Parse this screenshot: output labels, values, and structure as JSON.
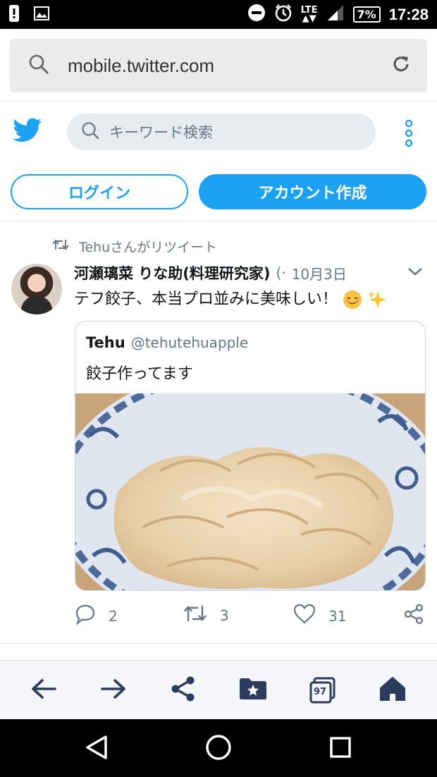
{
  "status_bar": {
    "network": "LTE",
    "battery": "7%",
    "time": "17:28"
  },
  "browser": {
    "url": "mobile.twitter.com"
  },
  "twitter_header": {
    "search_placeholder": "キーワード検索",
    "login_label": "ログイン",
    "signup_label": "アカウント作成"
  },
  "tweet": {
    "retweet_note": "Tehuさんがリツイート",
    "author_name": "河瀬璃菜 りな助(料理研究家)",
    "author_handle": "(·",
    "date": "10月3日",
    "text": "テフ餃子、本当プロ並みに美味しい！",
    "quote": {
      "name": "Tehu",
      "handle": "@tehutehuapple",
      "text": "餃子作ってます"
    },
    "reply_count": "2",
    "retweet_count": "3",
    "like_count": "31"
  },
  "toolbar": {
    "tab_count": "97"
  },
  "colors": {
    "twitter_blue": "#1da1f2",
    "toolbar_icon": "#2d3b5c"
  }
}
